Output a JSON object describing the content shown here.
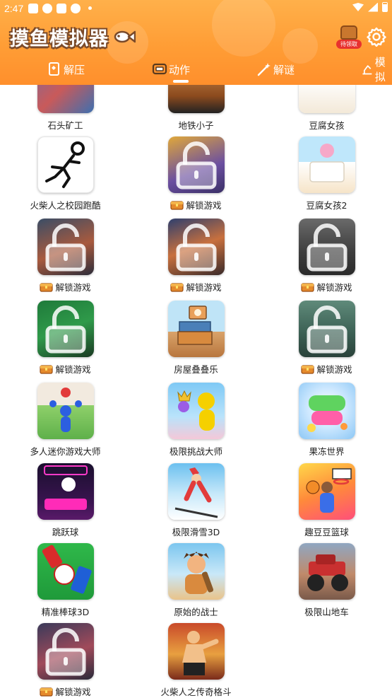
{
  "status_bar": {
    "time": "2:47"
  },
  "app": {
    "title": "摸鱼模拟器",
    "pending_badge": "待领取"
  },
  "tabs": [
    {
      "label": "解压",
      "icon": "card-hand-icon"
    },
    {
      "label": "动作",
      "icon": "game-console-icon",
      "active": true
    },
    {
      "label": "解谜",
      "icon": "magic-wand-icon"
    },
    {
      "label": "模拟",
      "icon": "crane-icon"
    }
  ],
  "games": [
    {
      "name": "石头矿工",
      "locked": false
    },
    {
      "name": "地铁小子",
      "locked": false
    },
    {
      "name": "豆腐女孩",
      "locked": false
    },
    {
      "name": "火柴人之校园跑酷",
      "locked": false
    },
    {
      "name": "解锁游戏",
      "locked": true
    },
    {
      "name": "豆腐女孩2",
      "locked": false
    },
    {
      "name": "解锁游戏",
      "locked": true
    },
    {
      "name": "解锁游戏",
      "locked": true
    },
    {
      "name": "解锁游戏",
      "locked": true
    },
    {
      "name": "解锁游戏",
      "locked": true
    },
    {
      "name": "房屋叠叠乐",
      "locked": false
    },
    {
      "name": "解锁游戏",
      "locked": true
    },
    {
      "name": "多人迷你游戏大师",
      "locked": false
    },
    {
      "name": "极限挑战大师",
      "locked": false
    },
    {
      "name": "果冻世界",
      "locked": false
    },
    {
      "name": "跳跃球",
      "locked": false
    },
    {
      "name": "极限滑雪3D",
      "locked": false
    },
    {
      "name": "趣豆豆篮球",
      "locked": false
    },
    {
      "name": "精准棒球3D",
      "locked": false
    },
    {
      "name": "原始的战士",
      "locked": false
    },
    {
      "name": "极限山地车",
      "locked": false
    },
    {
      "name": "解锁游戏",
      "locked": true
    },
    {
      "name": "火柴人之传奇格斗",
      "locked": false
    }
  ],
  "colors": {
    "header_orange": "#ff9d35",
    "logo_outline": "#7a4a2a",
    "badge_red": "#e8322e"
  }
}
